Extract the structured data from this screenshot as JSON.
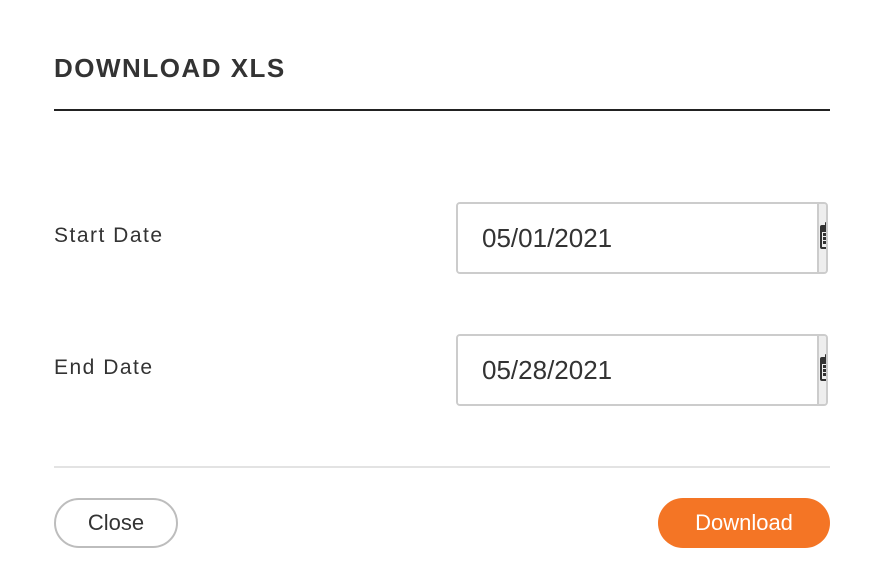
{
  "dialog": {
    "title": "DOWNLOAD XLS"
  },
  "form": {
    "start_date": {
      "label": "Start Date",
      "value": "05/01/2021",
      "icon": "calendar-icon"
    },
    "end_date": {
      "label": "End Date",
      "value": "05/28/2021",
      "icon": "calendar-icon"
    }
  },
  "footer": {
    "close_label": "Close",
    "download_label": "Download"
  },
  "colors": {
    "accent": "#f47525",
    "text": "#333333",
    "border": "#cccccc",
    "addon_bg": "#eeeeee"
  }
}
